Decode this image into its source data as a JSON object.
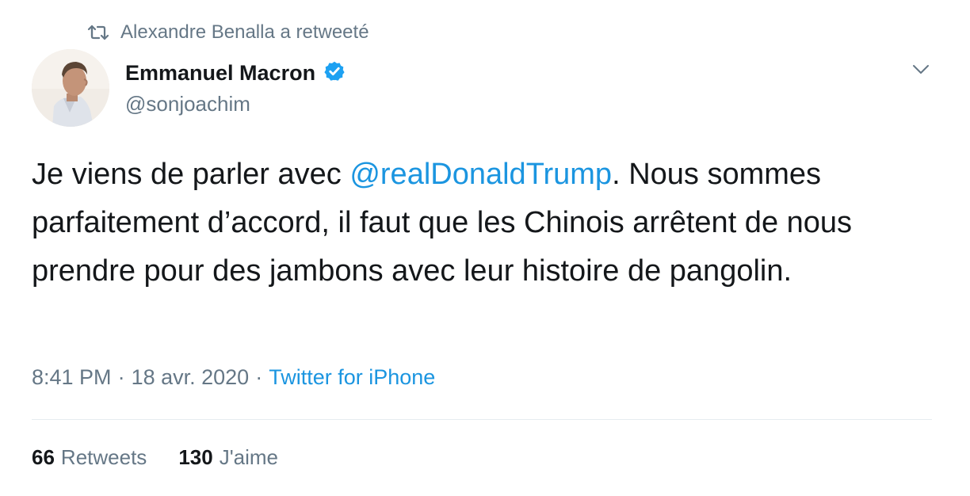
{
  "retweet_context": {
    "icon": "retweet-icon",
    "text": "Alexandre Benalla a retweeté"
  },
  "author": {
    "name": "Emmanuel Macron",
    "handle": "@sonjoachim",
    "verified": true,
    "verified_icon": "verified-badge-icon",
    "avatar": "avatar"
  },
  "menu": {
    "icon": "chevron-down-icon"
  },
  "tweet": {
    "text_before": "Je viens de parler avec ",
    "mention": "@realDonaldTrump",
    "text_after": ". Nous sommes parfaitement d’accord, il faut que les Chinois arrêtent de nous prendre pour des jambons avec leur histoire de pangolin."
  },
  "meta": {
    "time": "8:41 PM",
    "sep1": "·",
    "date": "18 avr. 2020",
    "sep2": "·",
    "source": "Twitter for iPhone"
  },
  "stats": {
    "retweets_count": "66",
    "retweets_label": "Retweets",
    "likes_count": "130",
    "likes_label": "J'aime"
  },
  "colors": {
    "link": "#1b95e0",
    "secondary": "#657786",
    "primary": "#14171a",
    "verified": "#1da1f2"
  }
}
